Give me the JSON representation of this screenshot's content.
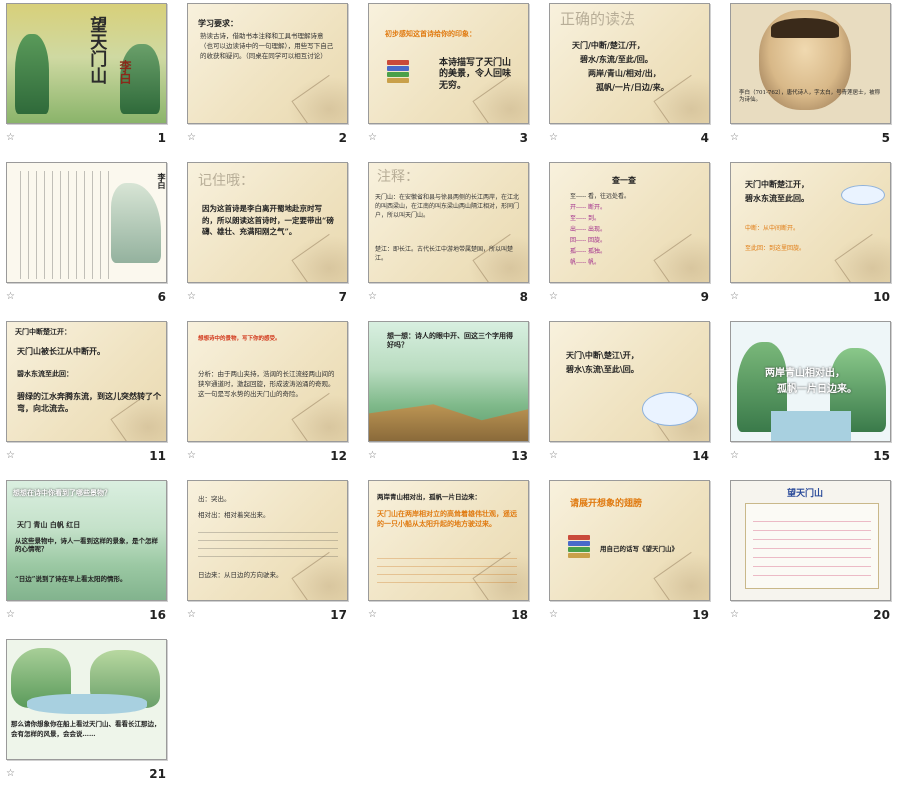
{
  "slides": [
    {
      "num": "1",
      "title": "望天门山",
      "author": "李白"
    },
    {
      "num": "2",
      "heading": "学习要求：",
      "body": "熟读古诗，借助书本注释和工具书理解诗意（也可以边读诗中的一句理解），用些写下自己的收获和疑问。（同桌在同学可以相互讨论）"
    },
    {
      "num": "3",
      "heading": "初步感知这首诗给你的印象：",
      "body": "本诗描写了天门山的美景，令人回味无穷。"
    },
    {
      "num": "4",
      "heading": "正确的读法",
      "lines": [
        "天门/中断/楚江/开，",
        "碧水/东流/至此/回。",
        "两岸/青山/相对/出，",
        "孤帆/一片/日边/来。"
      ]
    },
    {
      "num": "5",
      "caption": "李白（701-762），唐代诗人，字太白，号青莲居士，被称为诗仙。"
    },
    {
      "num": "6",
      "author": "李白"
    },
    {
      "num": "7",
      "faint": "记住哦：",
      "body": "因为这首诗是李白离开蜀地赴京时写的，所以朗读这首诗时，一定要带出“磅礴、雄壮、充满阳刚之气”。"
    },
    {
      "num": "8",
      "faint": "注释：",
      "body1": "天门山：在安徽省和县与徐县两侧的长江两岸，在江北的叫西梁山，在江南的叫东梁山两山隔江相对，形同门户，所以叫天门山。",
      "body2": "楚江：即长江。古代长江中游地带属楚国，所以叫楚江。"
    },
    {
      "num": "9",
      "heading": "查一查",
      "lines": [
        "至----- 看，往远处看。",
        "开----- 断开。",
        "至----- 到。",
        "出----- 出现。",
        "回----- 回旋。",
        "孤----- 孤独。",
        "帆----- 帆。"
      ]
    },
    {
      "num": "10",
      "line1": "天门中断楚江开，",
      "line2": "碧水东流至此回。",
      "note1": "中断：从中间断开。",
      "note2": "至此回：到这里回旋。"
    },
    {
      "num": "11",
      "heading": "天门中断楚江开：",
      "lines": [
        "天门山被长江从中断开。",
        "碧水东流至此回：",
        "碧绿的江水奔腾东流，到这儿突然转了个弯，向北流去。"
      ]
    },
    {
      "num": "12",
      "body": "想想诗中的景物，写下你的感受。",
      "analysis": "分析：由于两山夹持，浩阔的长江流经两山间的狭窄通道时，激起回旋，形成波涛汹涌的奇观。这一句是写水势的出天门山的奇险。"
    },
    {
      "num": "13",
      "heading": "想一想：诗人的眼中开、回这三个字用得好吗？"
    },
    {
      "num": "14",
      "lines": [
        "天门\\中断\\楚江\\开，",
        "碧水\\东流\\至此\\回。"
      ]
    },
    {
      "num": "15",
      "line1": "两岸青山相对出，",
      "line2": "孤帆一片日边来。"
    },
    {
      "num": "16",
      "heading": "想想在诗中你看到了哪些景物？",
      "lines": [
        "天门 青山 白帆 红日",
        "从这些景物中，诗人一看到这样的景象，是个怎样的心情呢？",
        "“日边”说到了诗在早上看太阳的情形。"
      ]
    },
    {
      "num": "17",
      "lines": [
        "出：突出。",
        "相对出：相对着突出来。",
        "日边来：从日边的方向驶来。"
      ]
    },
    {
      "num": "18",
      "heading": "两岸青山相对出，孤帆一片日边来：",
      "body": "天门山在两岸相对立的高耸着雄伟壮观，遥远的一只小船从太阳升起的地方驶过来。"
    },
    {
      "num": "19",
      "heading": "请展开想象的翅膀",
      "body": "用自己的话写《望天门山》"
    },
    {
      "num": "20",
      "title": "望天门山"
    },
    {
      "num": "21",
      "body": "那么请你想象你在船上看过天门山、看看长江那边，会有怎样的风景，会会说……"
    }
  ],
  "colors": {
    "paper": "#f4ecd4",
    "border": "#9a9a9a",
    "accent_red": "#d23a1e",
    "accent_orange": "#e07a10"
  },
  "icons": {
    "star": "☆"
  }
}
